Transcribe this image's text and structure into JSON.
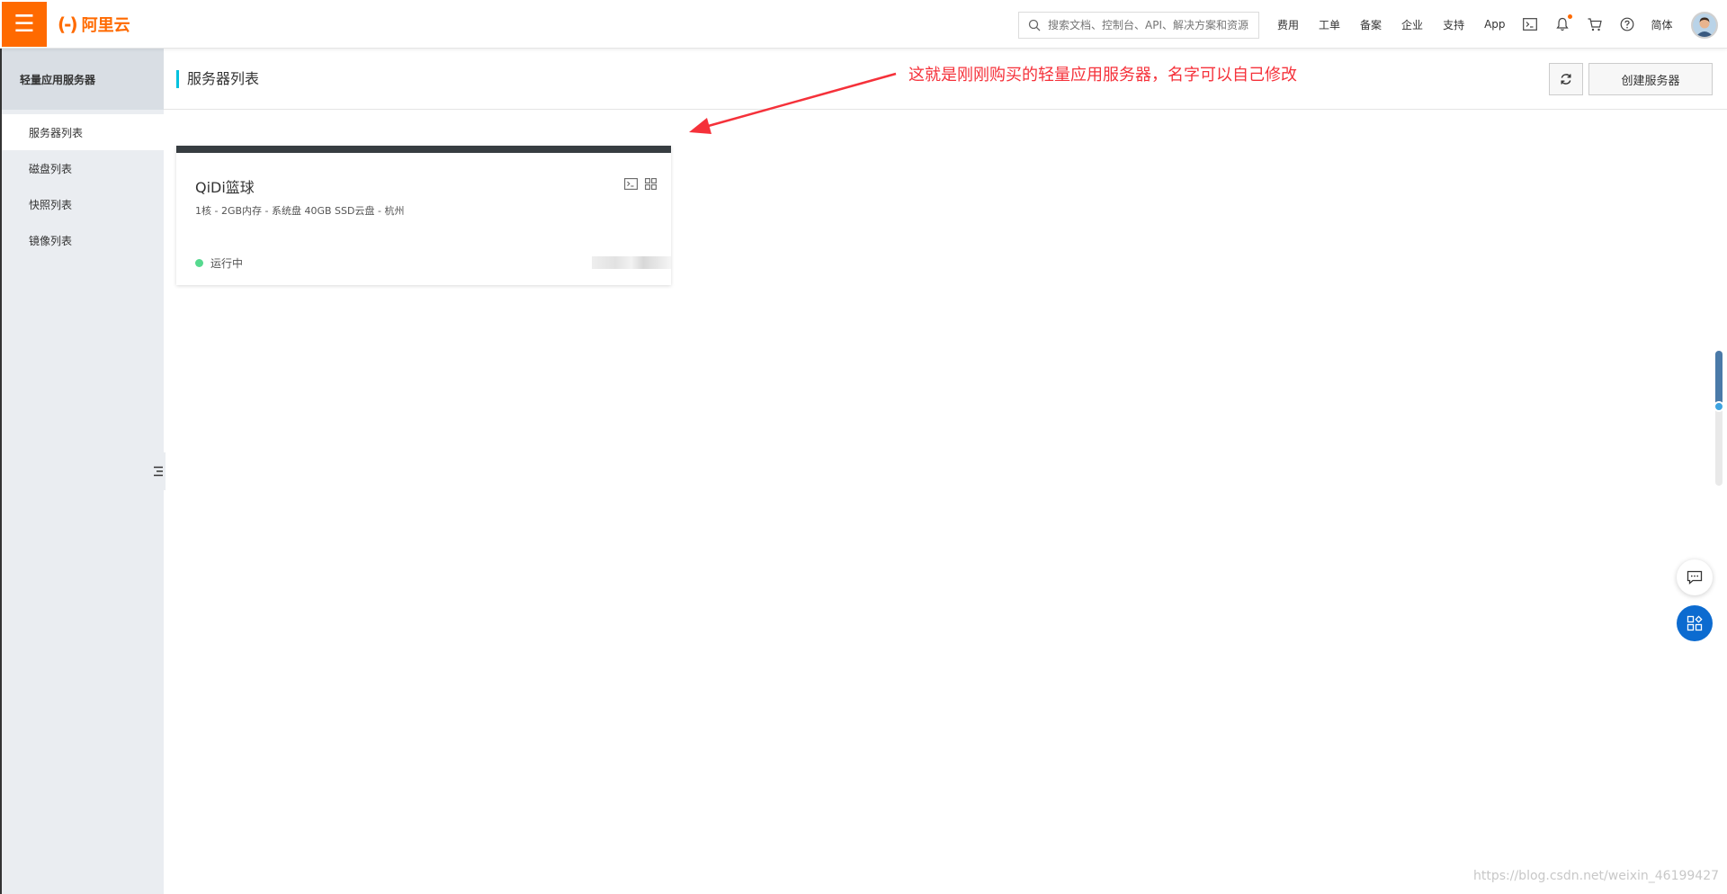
{
  "topbar": {
    "logo_text": "阿里云",
    "logo_mark": "(-)",
    "search_placeholder": "搜索文档、控制台、API、解决方案和资源",
    "nav": [
      "费用",
      "工单",
      "备案",
      "企业",
      "支持",
      "App"
    ],
    "lang": "简体",
    "accent_color": "#ff6a00"
  },
  "sidebar": {
    "title": "轻量应用服务器",
    "items": [
      {
        "label": "服务器列表",
        "active": true
      },
      {
        "label": "磁盘列表",
        "active": false
      },
      {
        "label": "快照列表",
        "active": false
      },
      {
        "label": "镜像列表",
        "active": false
      }
    ]
  },
  "header": {
    "title": "服务器列表",
    "annotation": "这就是刚刚购买的轻量应用服务器，名字可以自己修改",
    "create_label": "创建服务器"
  },
  "server": {
    "name": "QiDi篮球",
    "spec": "1核 - 2GB内存 - 系统盘 40GB SSD云盘 - 杭州",
    "status": "运行中",
    "status_color": "#1ecc6a"
  },
  "watermark": "https://blog.csdn.net/weixin_46199427"
}
